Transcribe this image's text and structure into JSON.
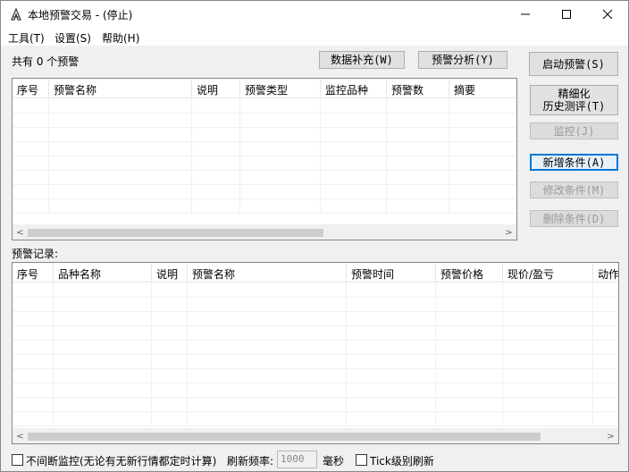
{
  "window": {
    "title": "本地预警交易  - (停止)",
    "minimize_glyph": "—",
    "maximize_glyph": "☐",
    "close_glyph": "✕"
  },
  "menu": [
    "工具(T)",
    "设置(S)",
    "帮助(H)"
  ],
  "top": {
    "count_text": "共有 0 个预警",
    "btn_fill_data": "数据补充(W)",
    "btn_analysis": "预警分析(Y)"
  },
  "right_buttons": {
    "start": "启动预警(S)",
    "refine_line1": "精细化",
    "refine_line2": "历史测评(T)",
    "monitor": "监控(J)",
    "add": "新增条件(A)",
    "edit": "修改条件(M)",
    "delete": "删除条件(D)"
  },
  "alerts_table": {
    "columns": [
      "序号",
      "预警名称",
      "说明",
      "预警类型",
      "监控品种",
      "预警数",
      "摘要"
    ]
  },
  "records": {
    "label": "预警记录:",
    "columns": [
      "序号",
      "品种名称",
      "说明",
      "预警名称",
      "预警时间",
      "预警价格",
      "现价/盈亏",
      "动作"
    ]
  },
  "bottom": {
    "continuous_label": "不间断监控(无论有无新行情都定时计算)",
    "refresh_label": "刷新频率:",
    "refresh_value": "1000",
    "unit": "毫秒",
    "tick_label": "Tick级别刷新"
  },
  "scroll": {
    "left": "<",
    "right": ">"
  }
}
